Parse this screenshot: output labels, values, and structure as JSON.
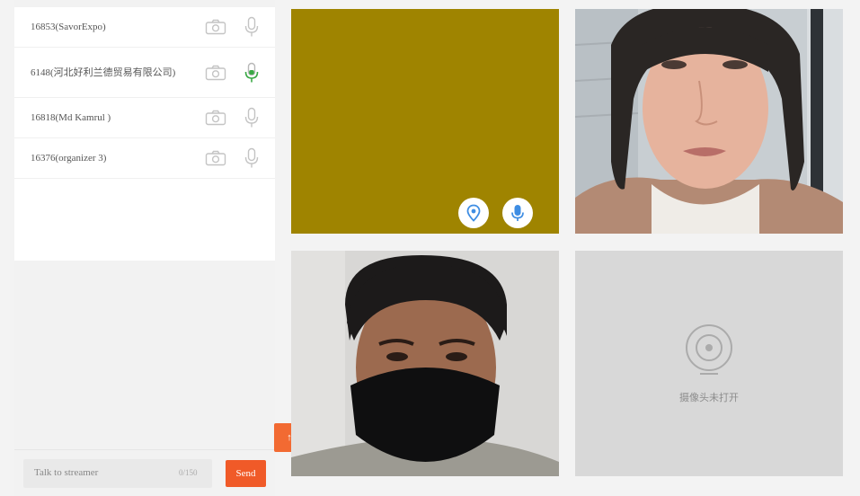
{
  "participants": [
    {
      "name": "16853(SavorExpo)",
      "mic_active": false
    },
    {
      "name": "6148(河北好利兰德贸易有限公司)",
      "mic_active": true
    },
    {
      "name": "16818(Md Kamrul )",
      "mic_active": false
    },
    {
      "name": "16376(organizer 3)",
      "mic_active": false
    }
  ],
  "chat": {
    "placeholder": "Talk to streamer",
    "counter": "0/150",
    "send_label": "Send"
  },
  "toggle_label": "↑",
  "camera_off_text": "摄像头未打开",
  "colors": {
    "accent": "#f05a28",
    "mic_active": "#3aa845",
    "olive_tile": "#9f8400",
    "tile_button_icon": "#3e8de3"
  }
}
